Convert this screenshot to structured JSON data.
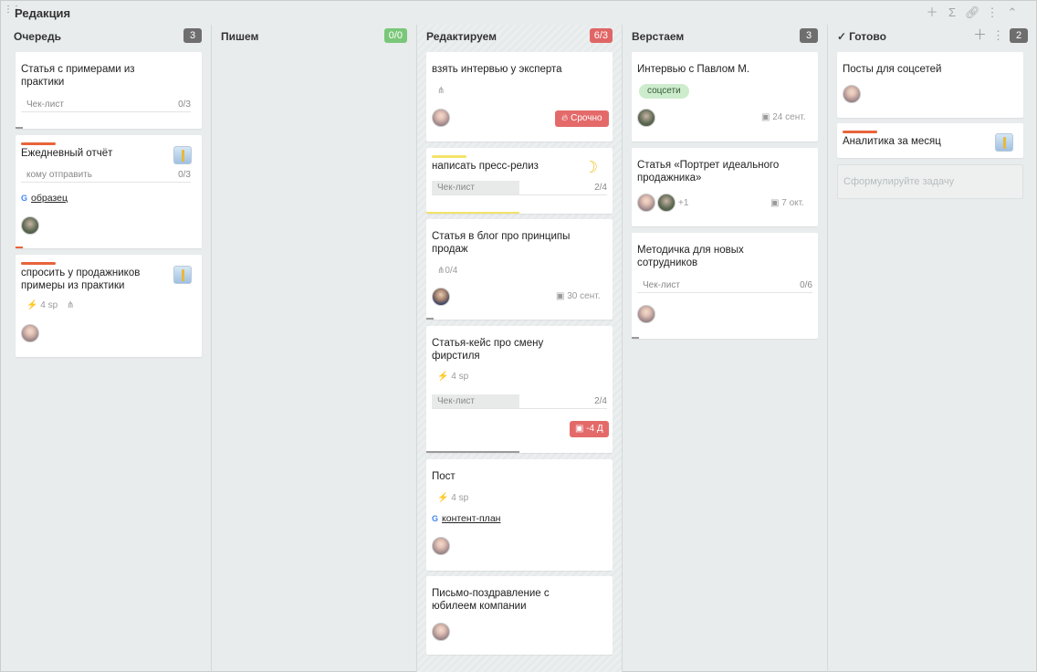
{
  "board": {
    "title": "Редакция",
    "tools": [
      "plus-icon",
      "sigma-icon",
      "link-icon",
      "more-icon",
      "collapse-icon"
    ]
  },
  "columns": {
    "queue": {
      "title": "Очередь",
      "count": "3",
      "cards": [
        {
          "title_lines": [
            "Статья с примерами из",
            "практики"
          ],
          "checklist_label": "Чек-лист",
          "checklist_count": "0/3"
        },
        {
          "title": "Ежедневный отчёт",
          "strip_color": "#e8643a",
          "checklist_label": "кому отправить",
          "checklist_count": "0/3",
          "link": "образец"
        },
        {
          "title_lines": [
            "спросить у продажников",
            "примеры из практики"
          ],
          "strip_color": "#e8643a",
          "sp": "4 sp"
        }
      ]
    },
    "writing": {
      "title": "Пишем",
      "count": "0/0"
    },
    "editing": {
      "title": "Редактируем",
      "count": "6/3",
      "cards": [
        {
          "title": "взять интервью у эксперта",
          "urgent": "Срочно"
        },
        {
          "title": "написать пресс-релиз",
          "strip_color": "#f3e36a",
          "checklist_label": "Чек-лист",
          "checklist_count": "2/4"
        },
        {
          "title_lines": [
            "Статья в блог про принципы",
            "продаж"
          ],
          "subtasks": "0/4",
          "date": "30 сент."
        },
        {
          "title_lines": [
            "Статья-кейс про смену",
            "фирстиля"
          ],
          "sp": "4 sp",
          "checklist_label": "Чек-лист",
          "checklist_count": "2/4",
          "overdue": "-4 Д"
        },
        {
          "title": "Пост",
          "sp": "4 sp",
          "link": "контент-план"
        },
        {
          "title_lines": [
            "Письмо-поздравление с",
            "юбилеем компании"
          ]
        }
      ]
    },
    "layout": {
      "title": "Верстаем",
      "count": "3",
      "cards": [
        {
          "title": "Интервью с Павлом М.",
          "tag": "соцсети",
          "date": "24 сент."
        },
        {
          "title_lines": [
            "Статья «Портрет идеального",
            "продажника»"
          ],
          "extra_members": "+1",
          "date": "7 окт."
        },
        {
          "title_lines": [
            "Методичка для новых",
            "сотрудников"
          ],
          "checklist_label": "Чек-лист",
          "checklist_count": "0/6"
        }
      ]
    },
    "done": {
      "title": "Готово",
      "count": "2",
      "cards": [
        {
          "title": "Посты для соцсетей"
        },
        {
          "title": "Аналитика за месяц",
          "strip_color": "#e8643a"
        }
      ],
      "new_task_placeholder": "Сформулируйте задачу"
    }
  }
}
